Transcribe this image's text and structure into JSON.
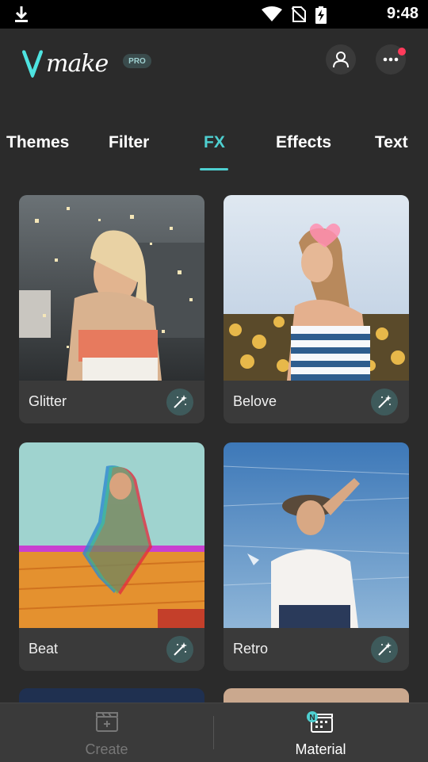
{
  "status_bar": {
    "time": "9:48",
    "icons": [
      "download-icon",
      "wifi-icon",
      "no-sim-icon",
      "battery-charging-icon"
    ]
  },
  "header": {
    "logo_text": "make",
    "pro_badge": "PRO",
    "icons": [
      "profile-icon",
      "more-icon"
    ],
    "colors": {
      "accent": "#4ecfd0",
      "logo_v": "#4ee3e0",
      "notification": "#ff3b5b"
    }
  },
  "tabs": [
    {
      "label": "Themes",
      "active": false
    },
    {
      "label": "Filter",
      "active": false
    },
    {
      "label": "FX",
      "active": true
    },
    {
      "label": "Effects",
      "active": false
    },
    {
      "label": "Text",
      "active": false
    }
  ],
  "cards": [
    {
      "label": "Glitter",
      "icon": "magic-wand-icon"
    },
    {
      "label": "Belove",
      "icon": "magic-wand-icon"
    },
    {
      "label": "Beat",
      "icon": "magic-wand-icon"
    },
    {
      "label": "Retro",
      "icon": "magic-wand-icon"
    }
  ],
  "bottom_nav": {
    "create_label": "Create",
    "material_label": "Material",
    "material_badge": "N",
    "active": "Material"
  }
}
